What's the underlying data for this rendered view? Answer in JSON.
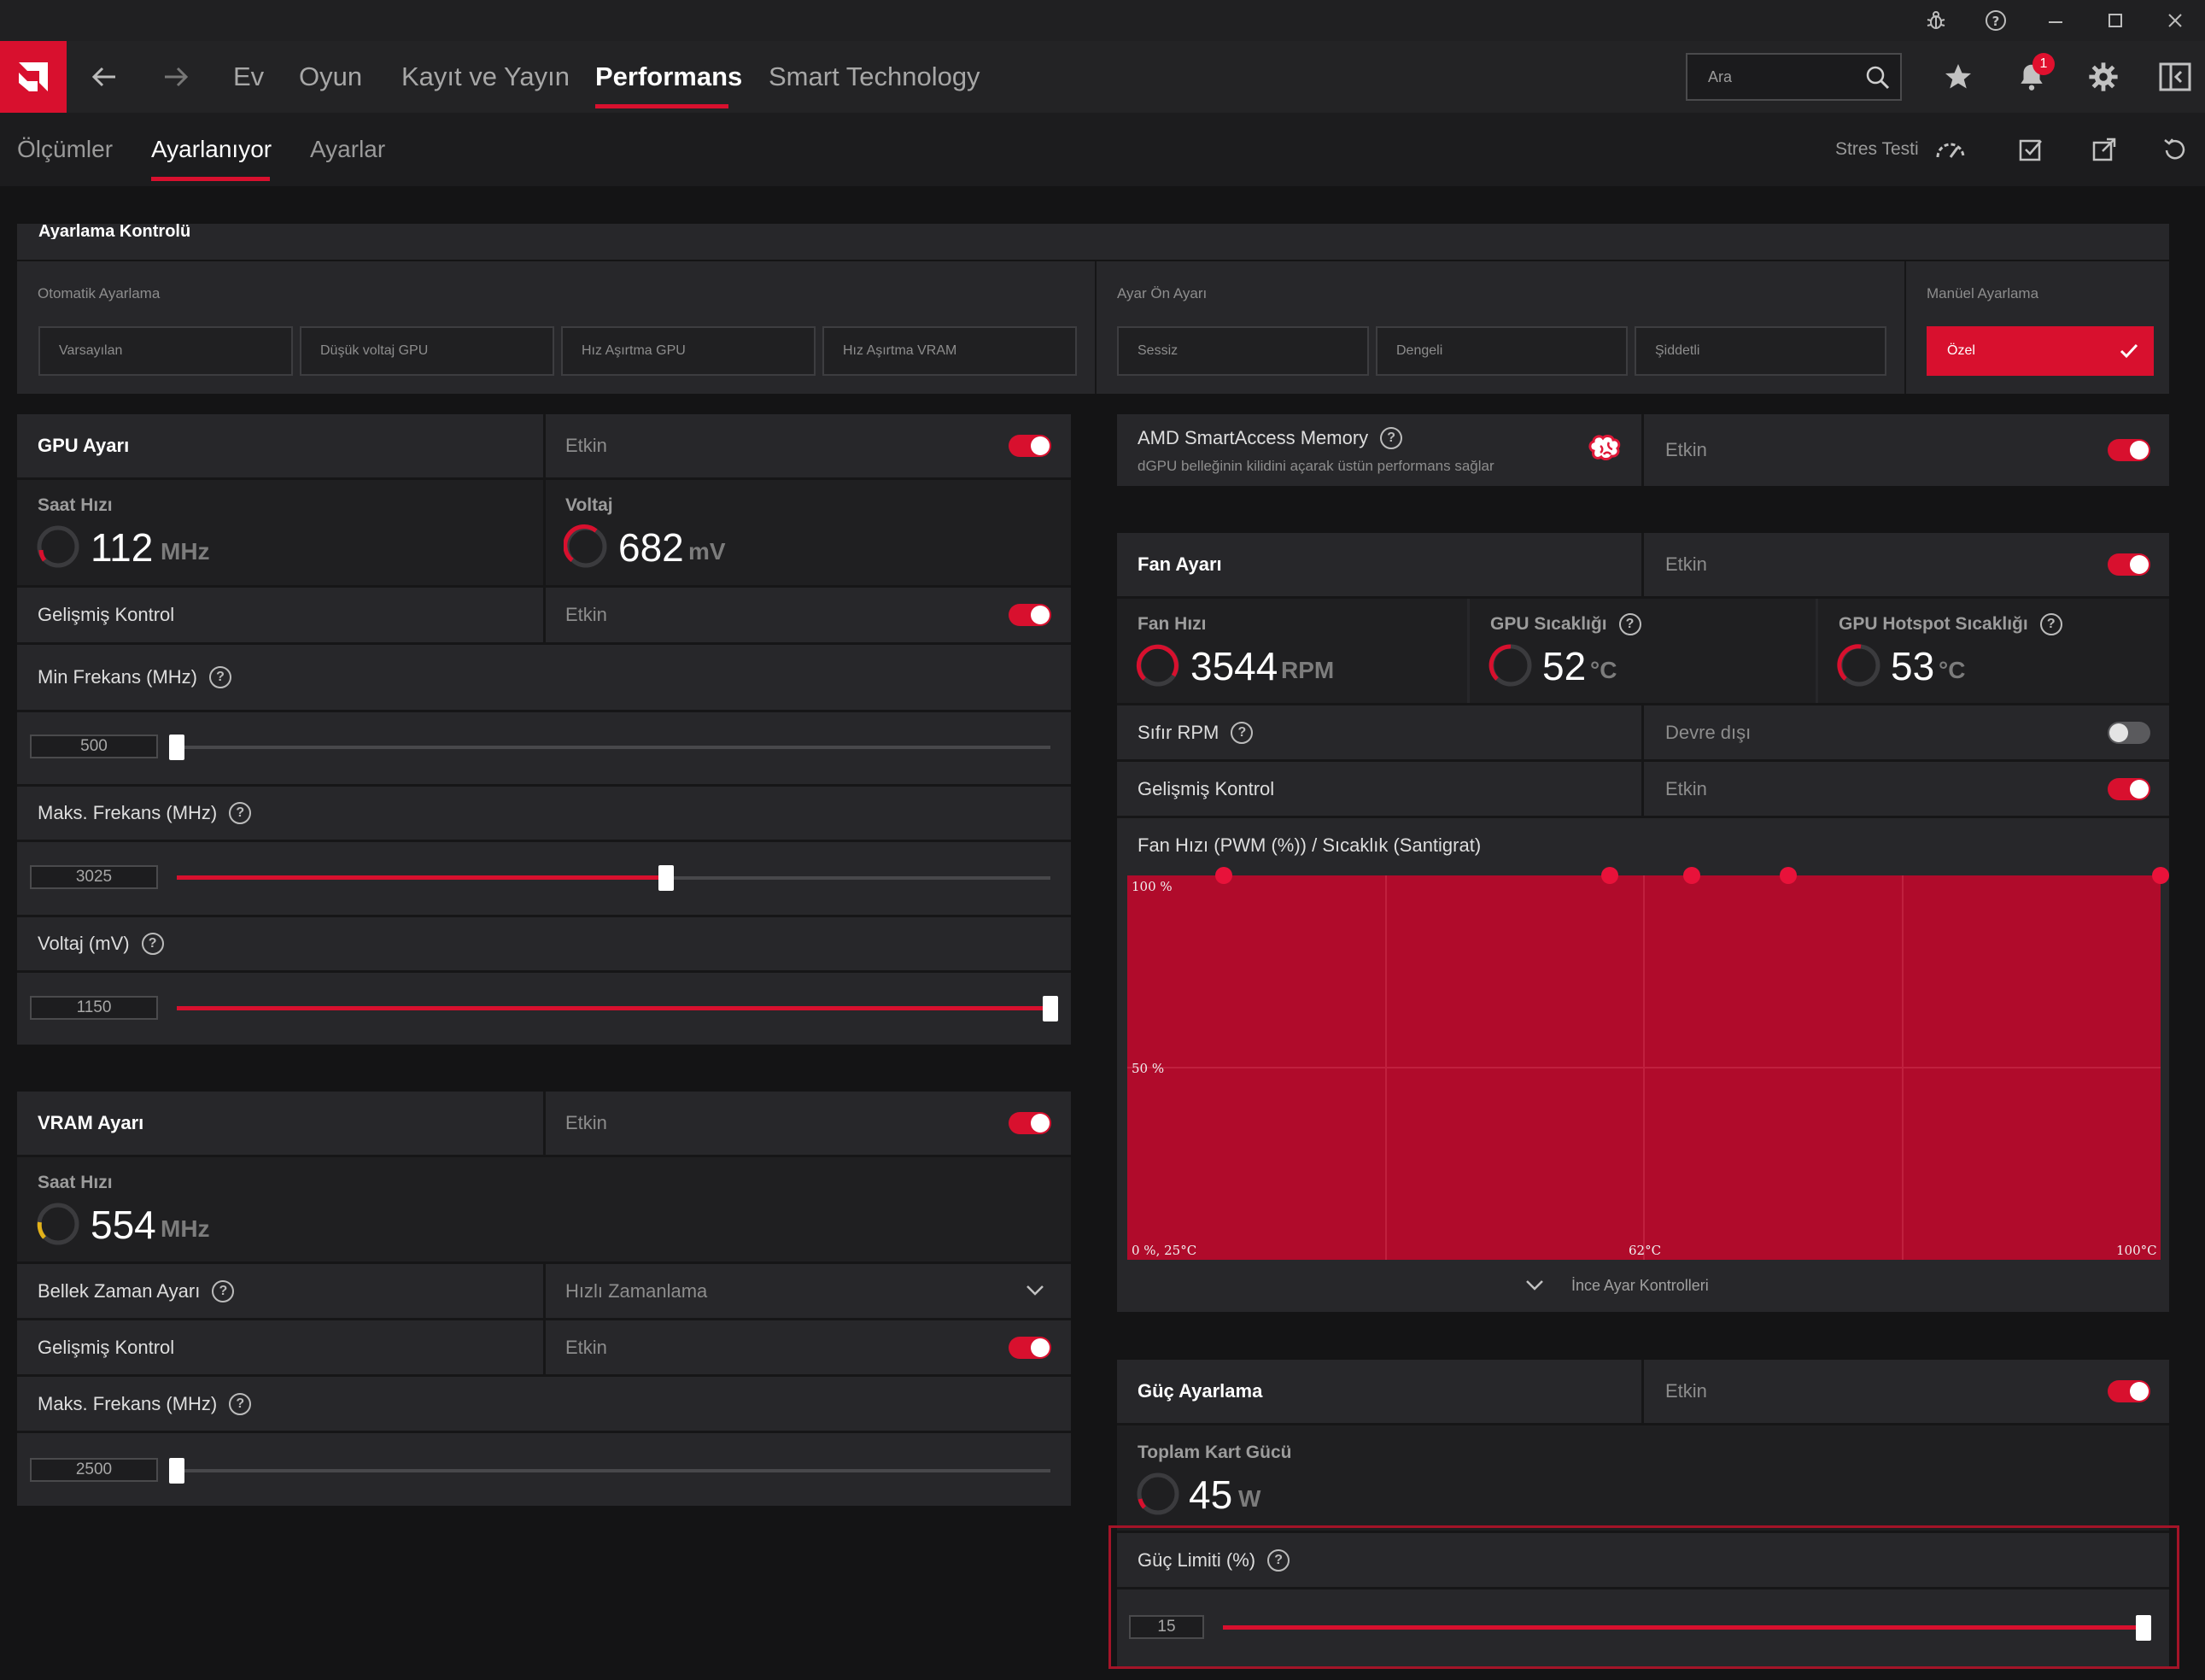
{
  "window": {
    "controls": [
      "bug-icon",
      "help-icon",
      "minimize-icon",
      "maximize-icon",
      "close-icon"
    ]
  },
  "nav": {
    "tabs": [
      {
        "label": "Ev"
      },
      {
        "label": "Oyun"
      },
      {
        "label": "Kayıt ve Yayın"
      },
      {
        "label": "Performans",
        "active": true
      },
      {
        "label": "Smart Technology"
      }
    ],
    "search_placeholder": "Ara",
    "notification_count": "1",
    "accent_color": "#d8102e"
  },
  "subnav": {
    "tabs": [
      {
        "label": "Ölçümler"
      },
      {
        "label": "Ayarlanıyor",
        "active": true
      },
      {
        "label": "Ayarlar"
      }
    ],
    "stress_test": "Stres Testi"
  },
  "tuning_control": {
    "title": "Ayarlama Kontrolü",
    "auto_label": "Otomatik Ayarlama",
    "auto_options": [
      "Varsayılan",
      "Düşük voltaj GPU",
      "Hız Aşırtma GPU",
      "Hız Aşırtma VRAM"
    ],
    "preset_label": "Ayar Ön Ayarı",
    "preset_options": [
      "Sessiz",
      "Dengeli",
      "Şiddetli"
    ],
    "manual_label": "Manüel Ayarlama",
    "manual_option": "Özel"
  },
  "gpu": {
    "title": "GPU Ayarı",
    "status": "Etkin",
    "clock_label": "Saat Hızı",
    "clock_value": "112",
    "clock_unit": "MHz",
    "voltage_label": "Voltaj",
    "voltage_value": "682",
    "voltage_unit": "mV",
    "advanced_label": "Gelişmiş Kontrol",
    "advanced_status": "Etkin",
    "min_freq_label": "Min Frekans (MHz)",
    "min_freq_value": "500",
    "min_freq_fraction": 0,
    "max_freq_label": "Maks. Frekans (MHz)",
    "max_freq_value": "3025",
    "max_freq_fraction": 0.56,
    "voltage_mv_label": "Voltaj (mV)",
    "voltage_mv_value": "1150",
    "voltage_mv_fraction": 1.0
  },
  "vram": {
    "title": "VRAM Ayarı",
    "status": "Etkin",
    "clock_label": "Saat Hızı",
    "clock_value": "554",
    "clock_unit": "MHz",
    "timing_label": "Bellek Zaman Ayarı",
    "timing_value": "Hızlı Zamanlama",
    "advanced_label": "Gelişmiş Kontrol",
    "advanced_status": "Etkin",
    "max_freq_label": "Maks. Frekans (MHz)",
    "max_freq_value": "2500",
    "max_freq_fraction": 0
  },
  "sam": {
    "title": "AMD SmartAccess Memory",
    "desc": "dGPU belleğinin kilidini açarak üstün performans sağlar",
    "status": "Etkin"
  },
  "fan": {
    "title": "Fan Ayarı",
    "status": "Etkin",
    "speed_label": "Fan Hızı",
    "speed_value": "3544",
    "speed_unit": "RPM",
    "gpu_temp_label": "GPU Sıcaklığı",
    "gpu_temp_value": "52",
    "gpu_temp_unit": "°C",
    "hotspot_label": "GPU Hotspot Sıcaklığı",
    "hotspot_value": "53",
    "hotspot_unit": "°C",
    "zero_rpm_label": "Sıfır RPM",
    "zero_rpm_status": "Devre dışı",
    "advanced_label": "Gelişmiş Kontrol",
    "advanced_status": "Etkin",
    "curve_label": "Fan Hızı (PWM (%)) / Sıcaklık (Santigrat)",
    "fine_tune_label": "İnce Ayar Kontrolleri"
  },
  "chart_data": {
    "type": "line",
    "title": "Fan Hızı (PWM (%)) / Sıcaklık (Santigrat)",
    "y_ticks": [
      "100 %",
      "50 %"
    ],
    "x_ticks": [
      "0 %, 25°C",
      "62°C",
      "100°C"
    ],
    "xlim": [
      25,
      100
    ],
    "ylim": [
      0,
      100
    ],
    "series": [
      {
        "x": [
          32,
          60,
          66,
          73,
          100
        ],
        "values": [
          100,
          100,
          100,
          100,
          100
        ]
      }
    ]
  },
  "power": {
    "title": "Güç Ayarlama",
    "status": "Etkin",
    "total_label": "Toplam Kart Gücü",
    "total_value": "45",
    "total_unit": "W",
    "limit_label": "Güç Limiti (%)",
    "limit_value": "15",
    "limit_fraction": 1.0
  }
}
